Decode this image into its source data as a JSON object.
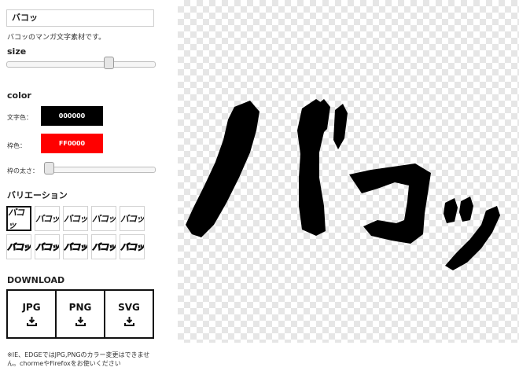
{
  "text": {
    "value": "バコッ",
    "description": "バコッのマンガ文字素材です。"
  },
  "size": {
    "label": "size",
    "value_fraction": 0.7
  },
  "color": {
    "label": "color",
    "text_color_label": "文字色：",
    "text_color_value": "000000",
    "text_color_hex": "#000000",
    "border_color_label": "枠色：",
    "border_color_value": "FF0000",
    "border_color_hex": "#ff0000",
    "border_width_label": "枠の太さ：",
    "border_width_fraction": 0.0
  },
  "variations": {
    "label": "バリエーション",
    "items": [
      {
        "text": "バコッ",
        "style": "solid"
      },
      {
        "text": "バコッ",
        "style": "solid"
      },
      {
        "text": "バコッ",
        "style": "solid"
      },
      {
        "text": "バコッ",
        "style": "solid"
      },
      {
        "text": "バコッ",
        "style": "solid"
      },
      {
        "text": "バコッ",
        "style": "outline"
      },
      {
        "text": "バコッ",
        "style": "outline"
      },
      {
        "text": "バコッ",
        "style": "outline"
      },
      {
        "text": "バコッ",
        "style": "outline"
      },
      {
        "text": "バコッ",
        "style": "outline"
      }
    ]
  },
  "download": {
    "label": "DOWNLOAD",
    "buttons": [
      {
        "label": "JPG",
        "icon": "download-icon"
      },
      {
        "label": "PNG",
        "icon": "download-icon"
      },
      {
        "label": "SVG",
        "icon": "download-icon"
      }
    ]
  },
  "note": "※IE、EDGEではJPG,PNGのカラー変更はできません。chormeやFirefoxをお使いください",
  "preview": {
    "fill_color": "#000000",
    "background": "transparent-checkerboard"
  }
}
